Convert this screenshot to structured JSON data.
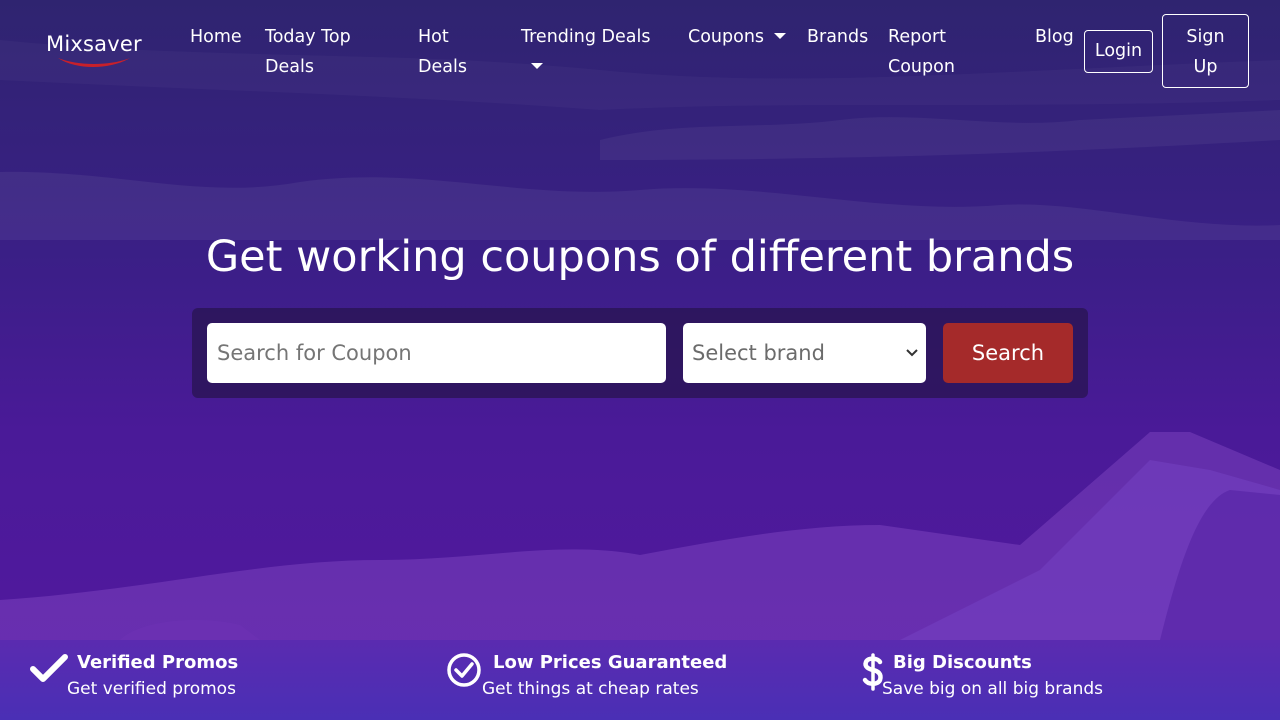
{
  "brand": {
    "name": "Mixsaver"
  },
  "nav": {
    "home": "Home",
    "today_top_deals": "Today Top Deals",
    "hot_deals": "Hot Deals",
    "trending_deals": "Trending Deals",
    "coupons": "Coupons",
    "brands": "Brands",
    "report_coupon": "Report Coupon",
    "blog": "Blog",
    "login": "Login",
    "signup": "Sign Up"
  },
  "hero": {
    "title": "Get working coupons of different brands"
  },
  "search": {
    "placeholder": "Search for Coupon",
    "brand_select": "Select brand",
    "button": "Search"
  },
  "features": [
    {
      "icon": "check-icon",
      "title": "Verified Promos",
      "subtitle": "Get verified promos"
    },
    {
      "icon": "check-circle-icon",
      "title": "Low Prices Guaranteed",
      "subtitle": "Get things at cheap rates"
    },
    {
      "icon": "dollar-icon",
      "title": "Big Discounts",
      "subtitle": "Save big on all big brands"
    }
  ],
  "colors": {
    "search_button": "#a52a2a",
    "logo_swoosh": "#c8202a"
  }
}
